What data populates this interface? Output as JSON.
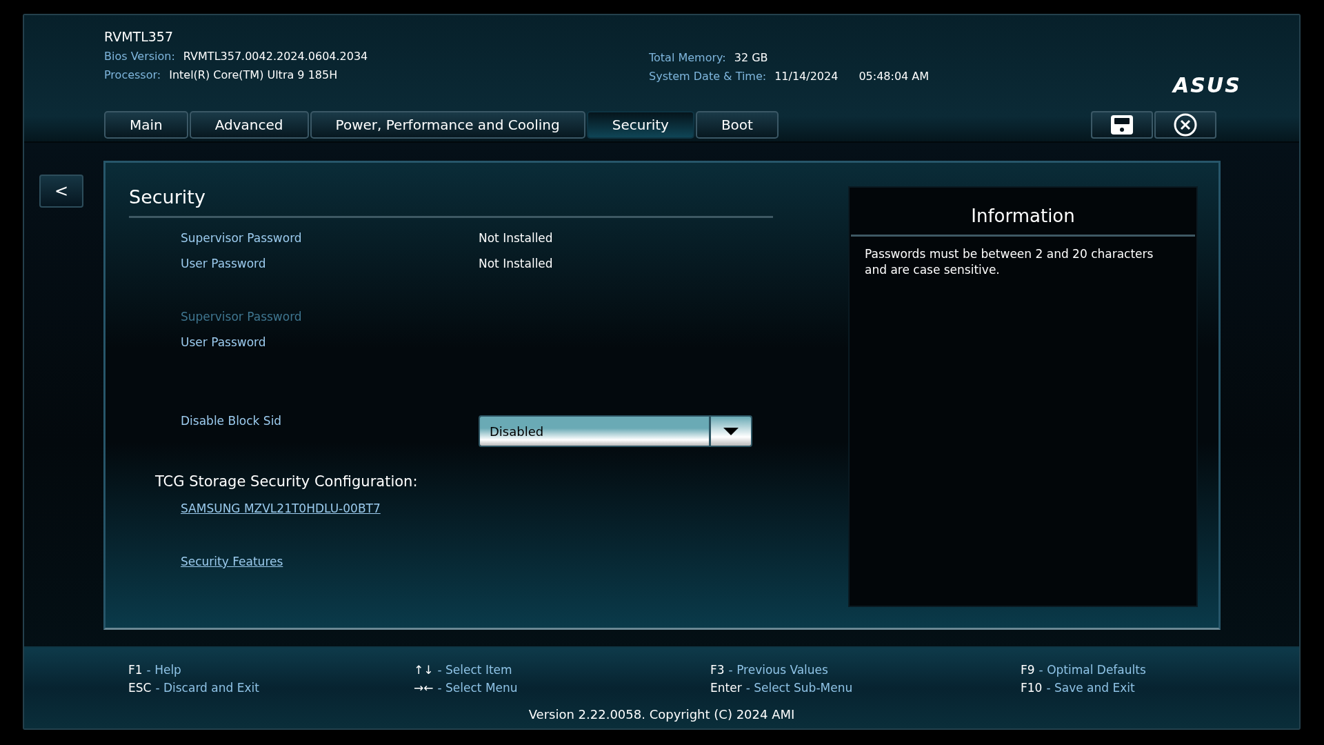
{
  "header": {
    "title": "RVMTL357",
    "info_left": [
      {
        "label": "Bios Version:",
        "value": "RVMTL357.0042.2024.0604.2034"
      },
      {
        "label": "Processor:",
        "value": "Intel(R) Core(TM) Ultra 9 185H"
      }
    ],
    "memory": {
      "label": "Total Memory:",
      "value": "32 GB"
    },
    "datetime": {
      "label": "System Date & Time:",
      "date": "11/14/2024",
      "time": "05:48:04 AM"
    },
    "logo": "ASUS"
  },
  "tabs": [
    {
      "label": "Main",
      "selected": false
    },
    {
      "label": "Advanced",
      "selected": false
    },
    {
      "label": "Power, Performance and Cooling",
      "selected": false
    },
    {
      "label": "Security",
      "selected": true
    },
    {
      "label": "Boot",
      "selected": false
    }
  ],
  "back_button": "<",
  "panel": {
    "title": "Security",
    "items": [
      {
        "kind": "info",
        "label": "Supervisor Password",
        "value": "Not Installed"
      },
      {
        "kind": "info",
        "label": "User Password",
        "value": "Not Installed"
      },
      {
        "kind": "spacer"
      },
      {
        "kind": "action",
        "label": "Supervisor Password",
        "disabled": true
      },
      {
        "kind": "action",
        "label": "User Password",
        "disabled": false
      },
      {
        "kind": "spacer"
      },
      {
        "kind": "dropdown",
        "label": "Disable Block Sid",
        "value": "Disabled"
      },
      {
        "kind": "heading",
        "label": "TCG Storage Security Configuration:"
      },
      {
        "kind": "link",
        "label": "SAMSUNG MZVL21T0HDLU-00BT7"
      },
      {
        "kind": "spacer"
      },
      {
        "kind": "link",
        "label": "Security Features"
      }
    ]
  },
  "information": {
    "title": "Information",
    "text": "Passwords must be between 2 and 20 characters and are case sensitive."
  },
  "footer": {
    "keys": [
      [
        {
          "key": "F1",
          "action": "- Help"
        },
        {
          "key": "ESC",
          "action": "- Discard and Exit"
        }
      ],
      [
        {
          "key": "↑↓",
          "action": "- Select Item"
        },
        {
          "key": "→←",
          "action": "- Select Menu"
        }
      ],
      [
        {
          "key": "F3",
          "action": "- Previous Values"
        },
        {
          "key": "Enter",
          "action": "- Select Sub-Menu"
        }
      ],
      [
        {
          "key": "F9",
          "action": "- Optimal Defaults"
        },
        {
          "key": "F10",
          "action": "- Save and Exit"
        }
      ]
    ],
    "version": "Version 2.22.0058. Copyright (C) 2024 AMI"
  }
}
